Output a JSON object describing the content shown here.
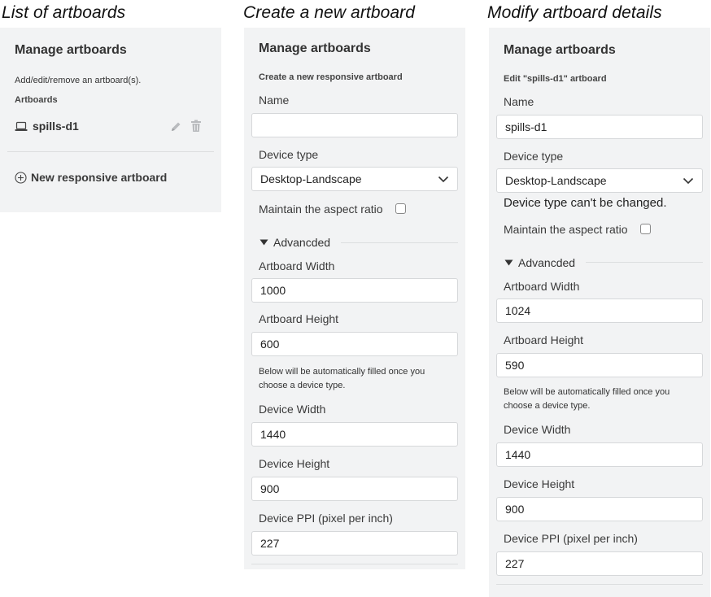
{
  "captions": {
    "list": "List of artboards",
    "create": "Create a new artboard",
    "modify": "Modify artboard details"
  },
  "list_panel": {
    "title": "Manage artboards",
    "description": "Add/edit/remove an artboard(s).",
    "section_label": "Artboards",
    "artboards": [
      {
        "name": "spills-d1",
        "icon": "laptop-icon"
      }
    ],
    "new_button_label": "New responsive artboard"
  },
  "create_panel": {
    "title": "Manage artboards",
    "subtitle": "Create a new responsive artboard",
    "name_label": "Name",
    "name_value": "",
    "device_type_label": "Device type",
    "device_type_value": "Desktop-Landscape",
    "aspect_label": "Maintain the aspect ratio",
    "aspect_checked": false,
    "advanced_label": "Advancded",
    "artboard_width_label": "Artboard Width",
    "artboard_width_value": "1000",
    "artboard_height_label": "Artboard Height",
    "artboard_height_value": "600",
    "note": "Below will be automatically filled once you choose a device type.",
    "device_width_label": "Device Width",
    "device_width_value": "1440",
    "device_height_label": "Device Height",
    "device_height_value": "900",
    "device_ppi_label": "Device PPI (pixel per inch)",
    "device_ppi_value": "227"
  },
  "modify_panel": {
    "title": "Manage artboards",
    "subtitle": "Edit \"spills-d1\" artboard",
    "name_label": "Name",
    "name_value": "spills-d1",
    "device_type_label": "Device type",
    "device_type_value": "Desktop-Landscape",
    "device_type_note": "Device type can't be changed.",
    "aspect_label": "Maintain the aspect ratio",
    "aspect_checked": false,
    "advanced_label": "Advancded",
    "artboard_width_label": "Artboard Width",
    "artboard_width_value": "1024",
    "artboard_height_label": "Artboard Height",
    "artboard_height_value": "590",
    "note": "Below will be automatically filled once you choose a device type.",
    "device_width_label": "Device Width",
    "device_width_value": "1440",
    "device_height_label": "Device Height",
    "device_height_value": "900",
    "device_ppi_label": "Device PPI (pixel per inch)",
    "device_ppi_value": "227"
  },
  "colors": {
    "panel_bg": "#f2f3f4",
    "border": "#d6d8da",
    "text": "#333333"
  },
  "icons": [
    "laptop-icon",
    "pencil-icon",
    "trash-icon",
    "plus-circle-icon",
    "chevron-down-icon",
    "triangle-down-icon"
  ]
}
